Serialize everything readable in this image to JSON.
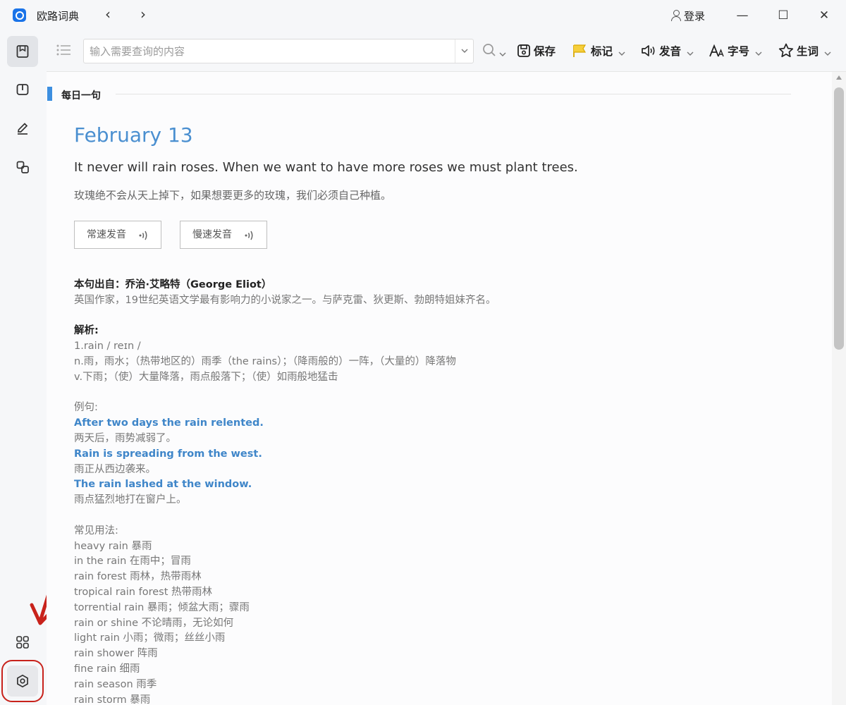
{
  "window": {
    "app_title": "欧路词典",
    "login_label": "登录",
    "minimize_glyph": "—",
    "maximize_glyph": "☐",
    "close_glyph": "✕"
  },
  "nav": {
    "back_glyph": "‹",
    "forward_glyph": "›"
  },
  "toolbar": {
    "search_placeholder": "输入需要查询的内容",
    "save_label": "保存",
    "mark_label": "标记",
    "pronounce_label": "发音",
    "font_size_label": "字号",
    "new_word_label": "生词"
  },
  "daily": {
    "section_title": "每日一句",
    "date": "February 13",
    "sentence_en": "It never will rain roses. When we want to have more roses we must plant trees.",
    "sentence_cn": "玫瑰绝不会从天上掉下，如果想要更多的玫瑰，我们必须自己种植。",
    "normal_speed_label": "常速发音",
    "slow_speed_label": "慢速发音",
    "source_heading": "本句出自：乔治·艾略特（George Eliot）",
    "source_desc": "英国作家，19世纪英语文学最有影响力的小说家之一。与萨克雷、狄更斯、勃朗特姐妹齐名。",
    "analysis_heading": "解析:",
    "analysis_lines": [
      "1.rain / reɪn /",
      "n.雨，雨水；（热带地区的）雨季（the rains）；（降雨般的）一阵，（大量的）降落物",
      "v.下雨；（使）大量降落，雨点般落下；（使）如雨般地猛击"
    ],
    "examples_heading": "例句:",
    "examples": [
      {
        "en": "After two days the rain relented.",
        "cn": "两天后，雨势减弱了。"
      },
      {
        "en": "Rain is spreading from the west.",
        "cn": "雨正从西边袭来。"
      },
      {
        "en": "The rain lashed at the window.",
        "cn": "雨点猛烈地打在窗户上。"
      }
    ],
    "usage_heading": "常见用法:",
    "usage_lines": [
      "heavy rain 暴雨",
      "in the rain 在雨中；冒雨",
      "rain forest 雨林，热带雨林",
      "tropical rain forest 热带雨林",
      "torrential rain 暴雨；倾盆大雨；骤雨",
      "rain or shine 不论晴雨，无论如何",
      "light rain 小雨；微雨；丝丝小雨",
      "rain shower 阵雨",
      "fine rain 细雨",
      "rain season 雨季",
      "rain storm 暴雨"
    ]
  },
  "sidebar": {
    "items": [
      {
        "icon": "dictionary-icon"
      },
      {
        "icon": "book-icon"
      },
      {
        "icon": "edit-icon"
      },
      {
        "icon": "translate-icon"
      },
      {
        "icon": "apps-grid-icon"
      },
      {
        "icon": "settings-icon"
      }
    ]
  },
  "colors": {
    "accent": "#3d8fe0",
    "date": "#4a8fd0",
    "example": "#3f86c9",
    "annotation": "#c8221b"
  }
}
